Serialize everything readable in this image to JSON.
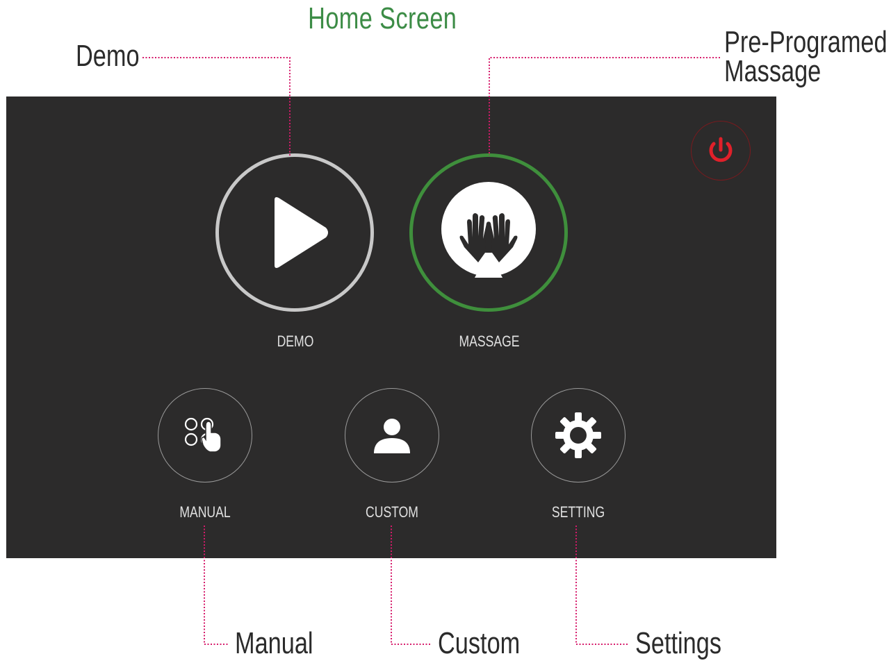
{
  "title": "Home Screen",
  "callouts": {
    "demo": "Demo",
    "pre_programed_line1": "Pre-Programed",
    "pre_programed_line2": "Massage",
    "manual": "Manual",
    "custom": "Custom",
    "settings": "Settings"
  },
  "screen": {
    "buttons": {
      "demo": "DEMO",
      "massage": "MASSAGE",
      "manual": "MANUAL",
      "custom": "CUSTOM",
      "setting": "SETTING"
    }
  },
  "colors": {
    "title": "#3c8c46",
    "screen_bg": "#2c2b2b",
    "demo_ring": "#c8c8c8",
    "massage_ring": "#3f8f3c",
    "power_icon": "#e0202a",
    "leader_line": "#d61a6a"
  },
  "icons": {
    "demo": "play-icon",
    "massage": "hands-icon",
    "manual": "touch-grid-icon",
    "custom": "user-icon",
    "setting": "gear-icon",
    "power": "power-icon"
  }
}
